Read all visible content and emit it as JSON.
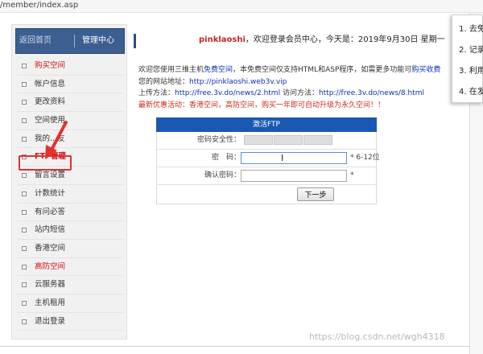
{
  "browser": {
    "url_fragment": "/member/index.asp"
  },
  "sidebar": {
    "back_label": "返回首页",
    "center_label": "管理中心",
    "items": [
      {
        "label": "购买空间",
        "style": "red"
      },
      {
        "label": "帐户信息",
        "style": "normal"
      },
      {
        "label": "更改资料",
        "style": "normal"
      },
      {
        "label": "空间使用",
        "style": "normal"
      },
      {
        "label": "我的...友",
        "style": "normal"
      },
      {
        "label": "FTP管理",
        "style": "ftp"
      },
      {
        "label": "留言设置",
        "style": "normal"
      },
      {
        "label": "计数统计",
        "style": "normal"
      },
      {
        "label": "有问必答",
        "style": "normal"
      },
      {
        "label": "站内短信",
        "style": "normal"
      },
      {
        "label": "香港空间",
        "style": "normal"
      },
      {
        "label": "高防空间",
        "style": "red"
      },
      {
        "label": "云服务器",
        "style": "normal"
      },
      {
        "label": "主机租用",
        "style": "normal"
      },
      {
        "label": "退出登录",
        "style": "normal"
      }
    ]
  },
  "welcome": {
    "username": "pinklaoshi",
    "text": "，欢迎登录会员中心，今天是：2019年9月30日 星期一"
  },
  "info": {
    "line1_prefix": "欢迎您使用三维主机",
    "line1_free": "免费空间",
    "line1_suffix": "，本免费空间仅支持HTML和ASP程序，如需更多功能可",
    "line1_buy": "购买收费",
    "line2_label": "您的网站地址：",
    "line2_url": "http://pinklaoshi.web3v.vip",
    "line3_label": "上传方法：",
    "line3_url1": "http://free.3v.do/news/2.html",
    "line3_mid": " 访问方法：",
    "line3_url2": "http://free.3v.do/news/8.html",
    "line4": "最新优惠活动：香港空间，高防空间，购买一年即可自动升级为永久空间！！"
  },
  "form": {
    "title": "激活FTP",
    "strength_label": "密码安全性：",
    "password_label": "密　码：",
    "password_value": "",
    "password_hint": "* 6-12位",
    "confirm_label": "确认密码：",
    "confirm_value": "",
    "confirm_hint": "*",
    "submit_label": "下一步"
  },
  "popup": {
    "items": [
      "1. 去免",
      "2. 记录",
      "3. 利用",
      "4. 在发"
    ]
  },
  "watermark": "https://blog.csdn.net/wgh4318",
  "colors": {
    "accent": "#1a58b2",
    "nav_header": "#3d5e90",
    "highlight": "#e5302d",
    "promo": "#d12b1b"
  }
}
